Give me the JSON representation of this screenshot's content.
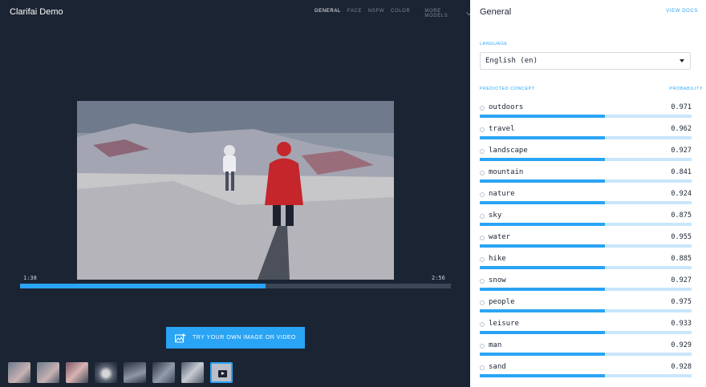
{
  "app": {
    "title": "Clarifai Demo"
  },
  "top_nav": {
    "items": [
      {
        "label": "GENERAL",
        "active": true
      },
      {
        "label": "FACE",
        "active": false
      },
      {
        "label": "NSFW",
        "active": false
      },
      {
        "label": "COLOR",
        "active": false
      }
    ],
    "more_label": "MORE MODELS"
  },
  "player": {
    "current_time": "1:38",
    "duration": "2:56",
    "progress": 0.57
  },
  "upload": {
    "label": "TRY YOUR OWN IMAGE OR VIDEO",
    "icon": "add-image-icon"
  },
  "thumbnails": [
    {
      "icon": "image-thumbnail"
    },
    {
      "icon": "image-thumbnail"
    },
    {
      "icon": "image-thumbnail"
    },
    {
      "icon": "image-thumbnail"
    },
    {
      "icon": "image-thumbnail"
    },
    {
      "icon": "image-thumbnail"
    },
    {
      "icon": "image-thumbnail"
    },
    {
      "icon": "video-play-icon",
      "selected": true
    }
  ],
  "panel": {
    "title": "General",
    "view_docs": "VIEW DOCS",
    "language_label": "LANGUAGE",
    "language_value": "English (en)",
    "col_concept": "PREDICTED CONCEPT",
    "col_probability": "PROBABILITY",
    "concepts": [
      {
        "name": "outdoors",
        "prob": "0.971",
        "bar": 0.59
      },
      {
        "name": "travel",
        "prob": "0.962",
        "bar": 0.59
      },
      {
        "name": "landscape",
        "prob": "0.927",
        "bar": 0.59
      },
      {
        "name": "mountain",
        "prob": "0.841",
        "bar": 0.59
      },
      {
        "name": "nature",
        "prob": "0.924",
        "bar": 0.59
      },
      {
        "name": "sky",
        "prob": "0.875",
        "bar": 0.59
      },
      {
        "name": "water",
        "prob": "0.955",
        "bar": 0.59
      },
      {
        "name": "hike",
        "prob": "0.885",
        "bar": 0.59
      },
      {
        "name": "snow",
        "prob": "0.927",
        "bar": 0.59
      },
      {
        "name": "people",
        "prob": "0.975",
        "bar": 0.59
      },
      {
        "name": "leisure",
        "prob": "0.933",
        "bar": 0.59
      },
      {
        "name": "man",
        "prob": "0.929",
        "bar": 0.59
      },
      {
        "name": "sand",
        "prob": "0.928",
        "bar": 0.59
      }
    ]
  },
  "colors": {
    "accent": "#2aa4f4",
    "background": "#1b2433",
    "panel": "#ffffff"
  }
}
